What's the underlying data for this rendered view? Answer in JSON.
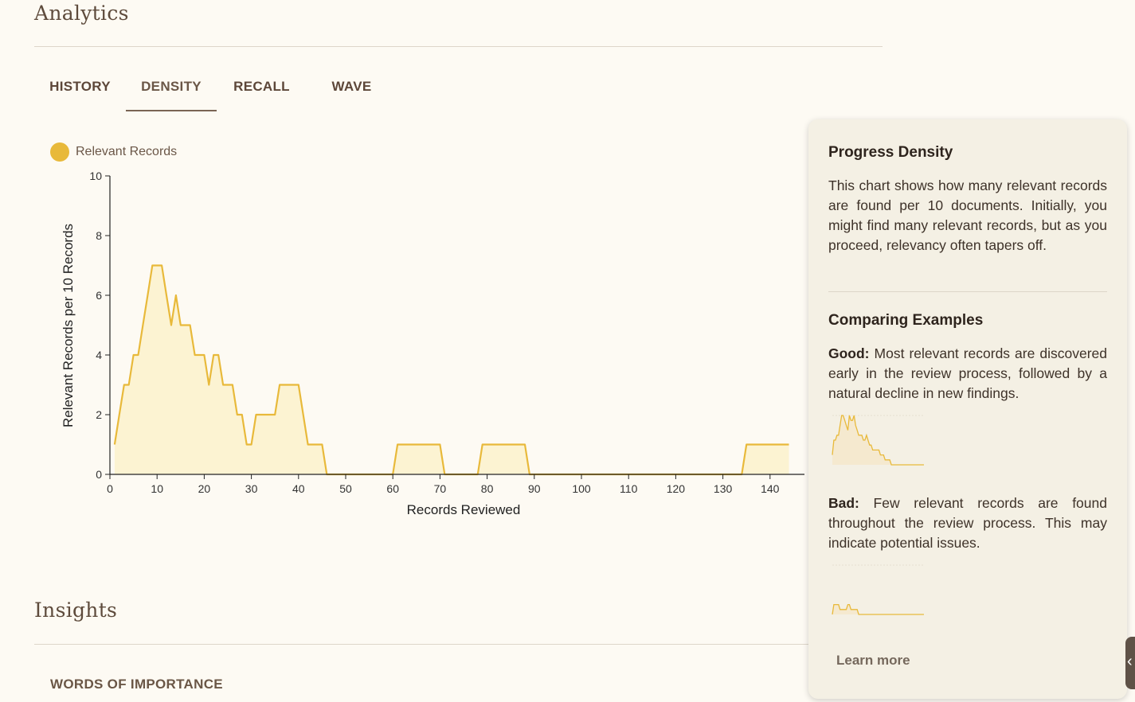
{
  "analytics": {
    "title": "Analytics",
    "tabs": [
      {
        "label": "HISTORY",
        "active": false
      },
      {
        "label": "DENSITY",
        "active": true
      },
      {
        "label": "RECALL",
        "active": false
      },
      {
        "label": "WAVE",
        "active": false
      }
    ]
  },
  "chart_data": {
    "type": "area",
    "legend": {
      "label": "Relevant Records",
      "color": "#e8b93a",
      "placement": "top-left"
    },
    "xlabel": "Records Reviewed",
    "ylabel": "Relevant Records per 10 Records",
    "xlim": [
      0,
      150
    ],
    "ylim": [
      0,
      10
    ],
    "xticks": [
      0,
      10,
      20,
      30,
      40,
      50,
      60,
      70,
      80,
      90,
      100,
      110,
      120,
      130,
      140
    ],
    "yticks": [
      0,
      2,
      4,
      6,
      8,
      10
    ],
    "line_color": "#e8b93a",
    "fill_color": "#fcf3d2",
    "series": [
      {
        "name": "Relevant Records",
        "x": [
          1,
          2,
          3,
          4,
          5,
          6,
          7,
          8,
          9,
          10,
          11,
          12,
          13,
          14,
          15,
          16,
          17,
          18,
          19,
          20,
          21,
          22,
          23,
          24,
          25,
          26,
          27,
          28,
          29,
          30,
          31,
          32,
          33,
          34,
          35,
          36,
          37,
          38,
          39,
          40,
          41,
          42,
          43,
          44,
          45,
          46,
          47,
          48,
          49,
          50,
          51,
          52,
          53,
          54,
          55,
          56,
          57,
          58,
          59,
          60,
          61,
          62,
          63,
          64,
          65,
          66,
          67,
          68,
          69,
          70,
          71,
          72,
          73,
          74,
          75,
          76,
          77,
          78,
          79,
          80,
          81,
          82,
          83,
          84,
          85,
          86,
          87,
          88,
          89,
          90,
          91,
          92,
          93,
          94,
          95,
          96,
          97,
          98,
          99,
          100,
          101,
          102,
          103,
          104,
          105,
          106,
          107,
          108,
          109,
          110,
          111,
          112,
          113,
          114,
          115,
          116,
          117,
          118,
          119,
          120,
          121,
          122,
          123,
          124,
          125,
          126,
          127,
          128,
          129,
          130,
          131,
          132,
          133,
          134,
          135,
          136,
          137,
          138,
          139,
          140,
          141,
          142,
          143,
          144
        ],
        "values": [
          1,
          2,
          3,
          3,
          4,
          4,
          5,
          6,
          7,
          7,
          7,
          6,
          5,
          6,
          5,
          5,
          5,
          4,
          4,
          4,
          3,
          4,
          4,
          3,
          3,
          3,
          2,
          2,
          1,
          1,
          2,
          2,
          2,
          2,
          2,
          3,
          3,
          3,
          3,
          3,
          2,
          1,
          1,
          1,
          1,
          0,
          0,
          0,
          0,
          0,
          0,
          0,
          0,
          0,
          0,
          0,
          0,
          0,
          0,
          0,
          1,
          1,
          1,
          1,
          1,
          1,
          1,
          1,
          1,
          1,
          0,
          0,
          0,
          0,
          0,
          0,
          0,
          0,
          1,
          1,
          1,
          1,
          1,
          1,
          1,
          1,
          1,
          1,
          0,
          0,
          0,
          0,
          0,
          0,
          0,
          0,
          0,
          0,
          0,
          0,
          0,
          0,
          0,
          0,
          0,
          0,
          0,
          0,
          0,
          0,
          0,
          0,
          0,
          0,
          0,
          0,
          0,
          0,
          0,
          0,
          0,
          0,
          0,
          0,
          0,
          0,
          0,
          0,
          0,
          0,
          0,
          0,
          0,
          0,
          1,
          1,
          1,
          1,
          1,
          1,
          1,
          1,
          1,
          1
        ]
      }
    ]
  },
  "tooltip": {
    "title": "Progress Density",
    "description": "This chart shows how many relevant records are found per 10 documents. Initially, you might find many relevant records, but as you proceed, relevancy often tapers off.",
    "examples_title": "Comparing Examples",
    "good_label": "Good:",
    "good_text": " Most relevant records are discovered early in the review process, followed by a natural decline in new findings.",
    "good_values": [
      2,
      5,
      5,
      6,
      6,
      8,
      10,
      10,
      9,
      8,
      7,
      10,
      9,
      9,
      10,
      8,
      7,
      6,
      6,
      6,
      5,
      5,
      6,
      5,
      4,
      4,
      3,
      3,
      3,
      3,
      3,
      2,
      2,
      2,
      1,
      1,
      1,
      1,
      0,
      0,
      0,
      0,
      0,
      0,
      0,
      0,
      0,
      0,
      0,
      0,
      0,
      0,
      0,
      0,
      0,
      0,
      0,
      0,
      0,
      0
    ],
    "bad_label": "Bad:",
    "bad_text": " Few relevant records are found throughout the review process. This may indicate potential issues.",
    "bad_values": [
      0,
      2,
      2,
      2,
      2,
      1,
      1,
      1,
      1,
      1,
      2,
      2,
      1,
      1,
      1,
      1,
      1,
      0,
      0,
      0,
      0,
      0,
      0,
      0,
      0,
      0,
      0,
      0,
      0,
      0,
      0,
      0,
      0,
      0,
      0,
      0,
      0,
      0,
      0,
      0,
      0,
      0,
      0,
      0,
      0,
      0,
      0,
      0,
      0,
      0,
      0,
      0,
      0,
      0,
      0,
      0,
      0,
      0,
      0,
      0
    ],
    "learn_more": "Learn more"
  },
  "insights": {
    "title": "Insights",
    "subheading": "WORDS OF IMPORTANCE"
  }
}
